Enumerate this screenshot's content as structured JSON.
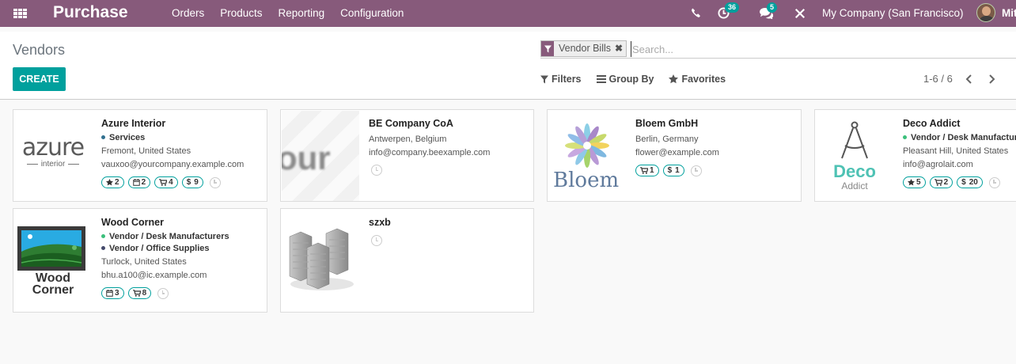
{
  "navbar": {
    "brand": "Purchase",
    "menu": [
      "Orders",
      "Products",
      "Reporting",
      "Configuration"
    ],
    "activity_count": "36",
    "message_count": "5",
    "company": "My Company (San Francisco)",
    "user": "Mitc"
  },
  "control": {
    "breadcrumb": "Vendors",
    "create_label": "CREATE",
    "facet_label": "Vendor Bills",
    "search_placeholder": "Search...",
    "filters_label": "Filters",
    "groupby_label": "Group By",
    "favorites_label": "Favorites",
    "pager": "1-6 / 6"
  },
  "vendors": [
    {
      "name": "Azure Interior",
      "tags": [
        {
          "label": "Services",
          "color": "#31708f"
        }
      ],
      "location": "Fremont, United States",
      "email": "vauxoo@yourcompany.example.com",
      "stats": [
        {
          "icon": "star-icon",
          "value": "2"
        },
        {
          "icon": "calendar-icon",
          "value": "2"
        },
        {
          "icon": "cart-icon",
          "value": "4"
        },
        {
          "icon": "dollar-icon",
          "value": "9"
        }
      ],
      "logo": "azure-logo",
      "logo_text": [
        "azure",
        "interior"
      ]
    },
    {
      "name": "BE Company CoA",
      "tags": [],
      "location": "Antwerpen, Belgium",
      "email": "info@company.beexample.com",
      "stats": [],
      "logo": "your-logo",
      "logo_text": [
        "our"
      ]
    },
    {
      "name": "Bloem GmbH",
      "tags": [],
      "location": "Berlin, Germany",
      "email": "flower@example.com",
      "stats": [
        {
          "icon": "cart-icon",
          "value": "1"
        },
        {
          "icon": "dollar-icon",
          "value": "1"
        }
      ],
      "logo": "bloem-logo",
      "logo_text": [
        "Bloem"
      ]
    },
    {
      "name": "Deco Addict",
      "tags": [
        {
          "label": "Vendor / Desk Manufacturers",
          "color": "#3bbf7b"
        }
      ],
      "location": "Pleasant Hill, United States",
      "email": "info@agrolait.com",
      "stats": [
        {
          "icon": "star-icon",
          "value": "5"
        },
        {
          "icon": "cart-icon",
          "value": "2"
        },
        {
          "icon": "dollar-icon",
          "value": "20"
        }
      ],
      "logo": "deco-logo",
      "logo_text": [
        "Deco",
        "Addict"
      ]
    },
    {
      "name": "Wood Corner",
      "tags": [
        {
          "label": "Vendor / Desk Manufacturers",
          "color": "#3bbf7b"
        },
        {
          "label": "Vendor / Office Supplies",
          "color": "#444a6b"
        }
      ],
      "location": "Turlock, United States",
      "email": "bhu.a100@ic.example.com",
      "stats": [
        {
          "icon": "calendar-icon",
          "value": "3"
        },
        {
          "icon": "cart-icon",
          "value": "8"
        }
      ],
      "logo": "wood-logo",
      "logo_text": [
        "Wood",
        "Corner"
      ]
    },
    {
      "name": "szxb",
      "tags": [],
      "location": "",
      "email": "",
      "stats": [],
      "logo": "building-icon",
      "logo_text": []
    }
  ]
}
